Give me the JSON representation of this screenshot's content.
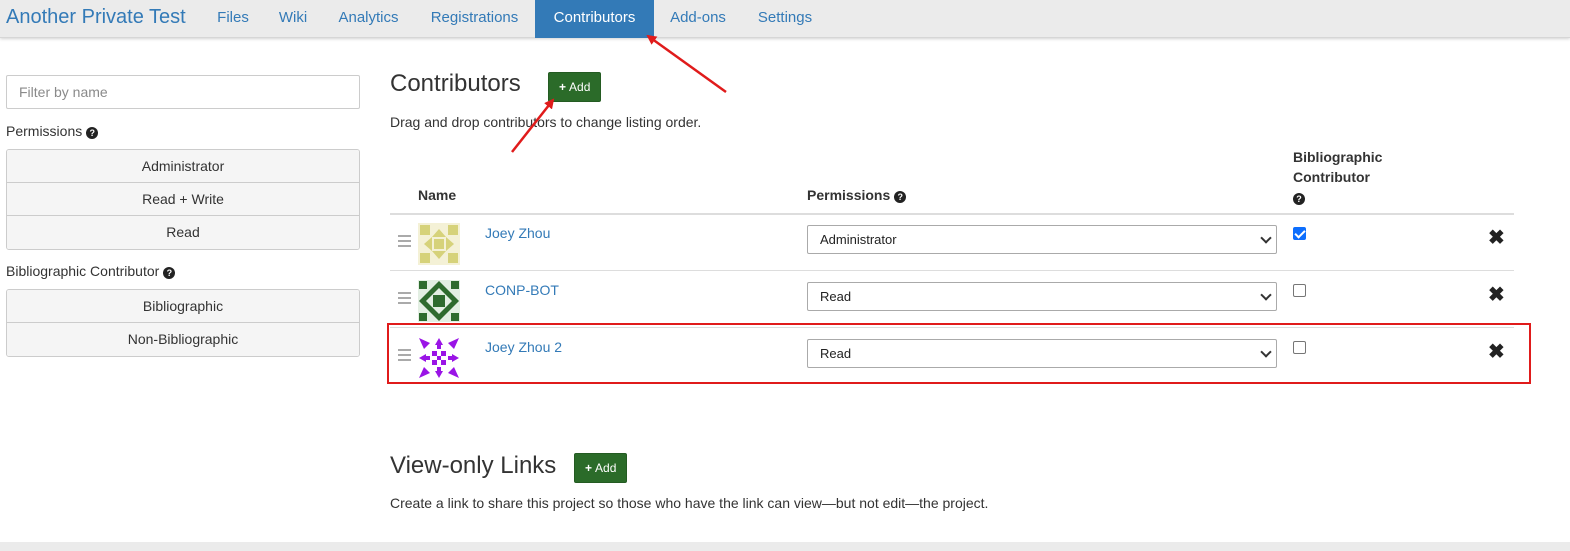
{
  "nav": {
    "brand": "Another Private Test",
    "items": [
      "Files",
      "Wiki",
      "Analytics",
      "Registrations",
      "Contributors",
      "Add-ons",
      "Settings"
    ],
    "active": "Contributors"
  },
  "sidebar": {
    "filter_placeholder": "Filter by name",
    "permissions_label": "Permissions",
    "permission_filters": [
      "Administrator",
      "Read + Write",
      "Read"
    ],
    "bibliographic_label": "Bibliographic Contributor",
    "bibliographic_filters": [
      "Bibliographic",
      "Non-Bibliographic"
    ]
  },
  "contributors": {
    "title": "Contributors",
    "add_label": "Add",
    "help_text": "Drag and drop contributors to change listing order.",
    "columns": {
      "name": "Name",
      "permissions": "Permissions",
      "bibliographic_line1": "Bibliographic",
      "bibliographic_line2": "Contributor"
    },
    "rows": [
      {
        "name": "Joey Zhou",
        "permission": "Administrator",
        "bibliographic": true,
        "avatar_color": "#d6d27a"
      },
      {
        "name": "CONP-BOT",
        "permission": "Read",
        "bibliographic": false,
        "avatar_color": "#2e6b2e"
      },
      {
        "name": "Joey Zhou 2",
        "permission": "Read",
        "bibliographic": false,
        "avatar_color": "#9a14e6"
      }
    ]
  },
  "view_only": {
    "title": "View-only Links",
    "add_label": "Add",
    "help_text": "Create a link to share this project so those who have the link can view—but not edit—the project."
  },
  "colors": {
    "link": "#337ab7",
    "add_button": "#2b6b29",
    "annotation_red": "#e01b1b",
    "checkbox_blue": "#0d6efd"
  }
}
